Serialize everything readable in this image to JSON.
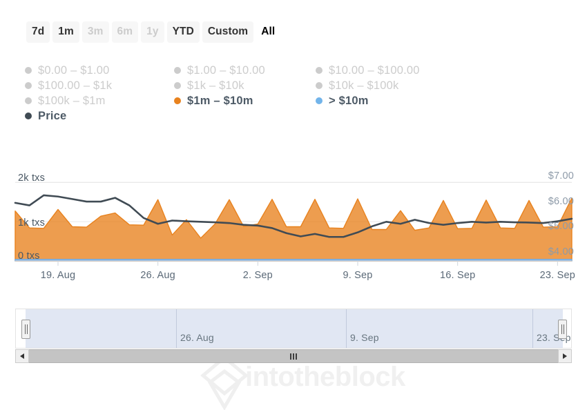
{
  "range_selector": {
    "buttons": [
      {
        "label": "7d",
        "state": "enabled"
      },
      {
        "label": "1m",
        "state": "enabled"
      },
      {
        "label": "3m",
        "state": "disabled"
      },
      {
        "label": "6m",
        "state": "disabled"
      },
      {
        "label": "1y",
        "state": "disabled"
      },
      {
        "label": "YTD",
        "state": "enabled"
      },
      {
        "label": "Custom",
        "state": "enabled"
      },
      {
        "label": "All",
        "state": "selected"
      }
    ]
  },
  "legend": {
    "items": [
      {
        "label": "$0.00 – $1.00",
        "color": "#cccccc",
        "active": false
      },
      {
        "label": "$1.00 – $10.00",
        "color": "#cccccc",
        "active": false
      },
      {
        "label": "$10.00 – $100.00",
        "color": "#cccccc",
        "active": false
      },
      {
        "label": "$100.00 – $1k",
        "color": "#cccccc",
        "active": false
      },
      {
        "label": "$1k – $10k",
        "color": "#cccccc",
        "active": false
      },
      {
        "label": "$10k – $100k",
        "color": "#cccccc",
        "active": false
      },
      {
        "label": "$100k – $1m",
        "color": "#cccccc",
        "active": false
      },
      {
        "label": "$1m – $10m",
        "color": "#e8821e",
        "active": true
      },
      {
        "label": "> $10m",
        "color": "#72b4ea",
        "active": true
      },
      {
        "label": "Price",
        "color": "#404b54",
        "active": true
      }
    ]
  },
  "watermark": {
    "text": "intotheblock"
  },
  "navigator": {
    "dates": [
      "26. Aug",
      "9. Sep",
      "23. Sep"
    ],
    "handle_left_label": "navigator-left-handle",
    "handle_right_label": "navigator-right-handle"
  },
  "scrollbar": {
    "left_arrow": "◀",
    "right_arrow": "▶"
  },
  "chart_data": {
    "type": "area",
    "title": "",
    "xlabel": "",
    "ylabel": "txs",
    "y2label": "Price",
    "grid": true,
    "legend_position": "top",
    "x_tick_labels": [
      "19. Aug",
      "26. Aug",
      "2. Sep",
      "9. Sep",
      "16. Sep",
      "23. Sep"
    ],
    "y_left_ticks": [
      "0 txs",
      "1k txs",
      "2k txs"
    ],
    "y_left_values": [
      0,
      1000,
      2000
    ],
    "ylim": [
      0,
      2250
    ],
    "y_right_ticks": [
      "$4.00",
      "$5.00",
      "$6.00",
      "$7.00"
    ],
    "y_right_values": [
      4,
      5,
      6,
      7
    ],
    "y2lim": [
      3.75,
      7.25
    ],
    "x": [
      "16. Aug",
      "17. Aug",
      "18. Aug",
      "19. Aug",
      "20. Aug",
      "21. Aug",
      "22. Aug",
      "23. Aug",
      "24. Aug",
      "25. Aug",
      "26. Aug",
      "27. Aug",
      "28. Aug",
      "29. Aug",
      "30. Aug",
      "31. Aug",
      "1. Sep",
      "2. Sep",
      "3. Sep",
      "4. Sep",
      "5. Sep",
      "6. Sep",
      "7. Sep",
      "8. Sep",
      "9. Sep",
      "10. Sep",
      "11. Sep",
      "12. Sep",
      "13. Sep",
      "14. Sep",
      "15. Sep",
      "16. Sep",
      "17. Sep",
      "18. Sep",
      "19. Sep",
      "20. Sep",
      "21. Sep",
      "22. Sep",
      "23. Sep",
      "24. Sep"
    ],
    "series": [
      {
        "name": "$1m – $10m",
        "type": "area",
        "color": "#e8821e",
        "axis": "left",
        "unit": "txs",
        "values": [
          1230,
          800,
          790,
          1270,
          830,
          820,
          1100,
          1180,
          880,
          870,
          1520,
          620,
          1010,
          540,
          900,
          1520,
          840,
          900,
          1530,
          830,
          830,
          1530,
          800,
          790,
          1540,
          760,
          760,
          1240,
          740,
          800,
          1500,
          780,
          790,
          1510,
          800,
          790,
          1500,
          820,
          830,
          1560
        ]
      },
      {
        "name": "> $10m",
        "type": "area",
        "color": "#72b4ea",
        "axis": "left",
        "unit": "txs",
        "values": [
          40,
          40,
          40,
          40,
          40,
          40,
          40,
          40,
          40,
          40,
          40,
          40,
          40,
          40,
          40,
          40,
          40,
          40,
          40,
          40,
          40,
          40,
          40,
          40,
          40,
          40,
          40,
          40,
          40,
          40,
          40,
          40,
          40,
          40,
          40,
          40,
          40,
          40,
          40,
          40
        ]
      },
      {
        "name": "Price",
        "type": "line",
        "color": "#404b54",
        "axis": "right",
        "unit": "USD",
        "values": [
          6.05,
          5.95,
          6.35,
          6.3,
          6.2,
          6.1,
          6.1,
          6.25,
          5.95,
          5.45,
          5.22,
          5.35,
          5.32,
          5.3,
          5.28,
          5.25,
          5.18,
          5.15,
          5.05,
          4.85,
          4.72,
          4.82,
          4.7,
          4.7,
          4.88,
          5.12,
          5.3,
          5.22,
          5.38,
          5.25,
          5.18,
          5.25,
          5.3,
          5.27,
          5.3,
          5.28,
          5.27,
          5.25,
          5.32,
          5.42
        ]
      }
    ]
  }
}
